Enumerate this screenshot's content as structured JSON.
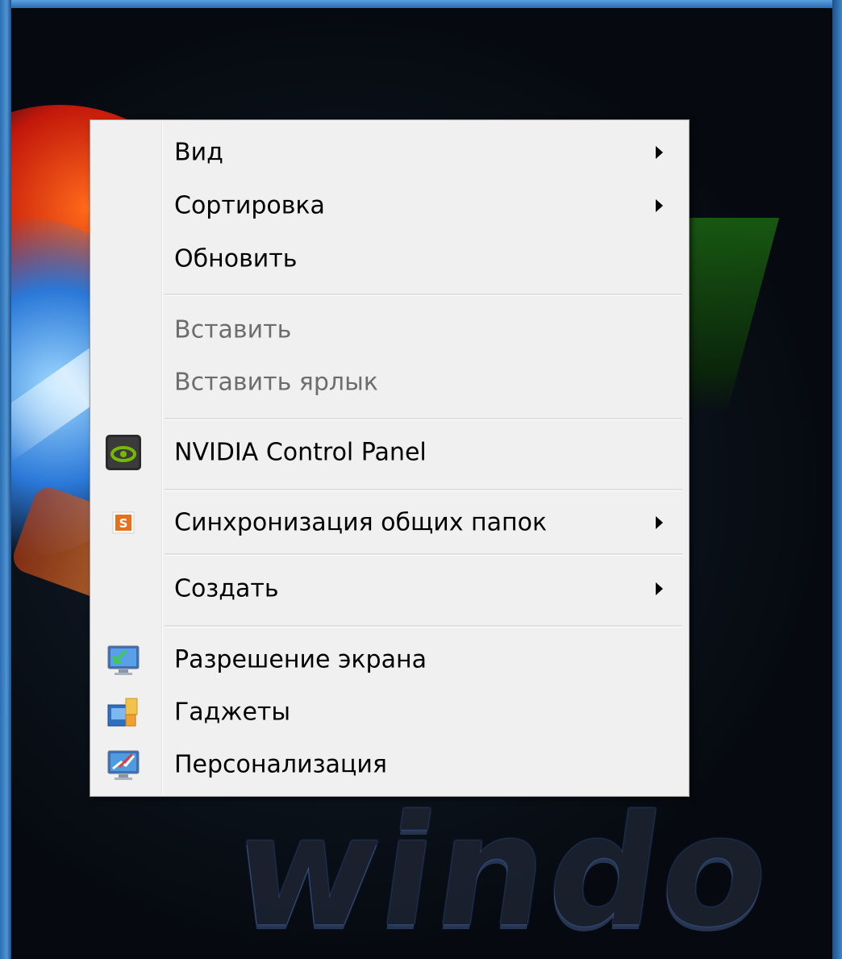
{
  "desktop": {
    "wordmark": "windo"
  },
  "context_menu": {
    "items": [
      {
        "label": "Вид",
        "has_submenu": true,
        "enabled": true
      },
      {
        "label": "Сортировка",
        "has_submenu": true,
        "enabled": true
      },
      {
        "label": "Обновить",
        "has_submenu": false,
        "enabled": true
      },
      {
        "label": "Вставить",
        "has_submenu": false,
        "enabled": false
      },
      {
        "label": "Вставить ярлык",
        "has_submenu": false,
        "enabled": false
      },
      {
        "label": "NVIDIA Control Panel",
        "has_submenu": false,
        "enabled": true,
        "icon": "nvidia-icon"
      },
      {
        "label": "Синхронизация общих папок",
        "has_submenu": true,
        "enabled": true,
        "icon": "sharepoint-sync-icon"
      },
      {
        "label": "Создать",
        "has_submenu": true,
        "enabled": true
      },
      {
        "label": "Разрешение экрана",
        "has_submenu": false,
        "enabled": true,
        "icon": "screen-resolution-icon"
      },
      {
        "label": "Гаджеты",
        "has_submenu": false,
        "enabled": true,
        "icon": "gadgets-icon"
      },
      {
        "label": "Персонализация",
        "has_submenu": false,
        "enabled": true,
        "icon": "personalization-icon"
      }
    ]
  },
  "colors": {
    "menu_background": "#f0f0f0",
    "menu_border": "#979797",
    "disabled_text": "#6d6d6d",
    "nvidia_green": "#76b900"
  }
}
